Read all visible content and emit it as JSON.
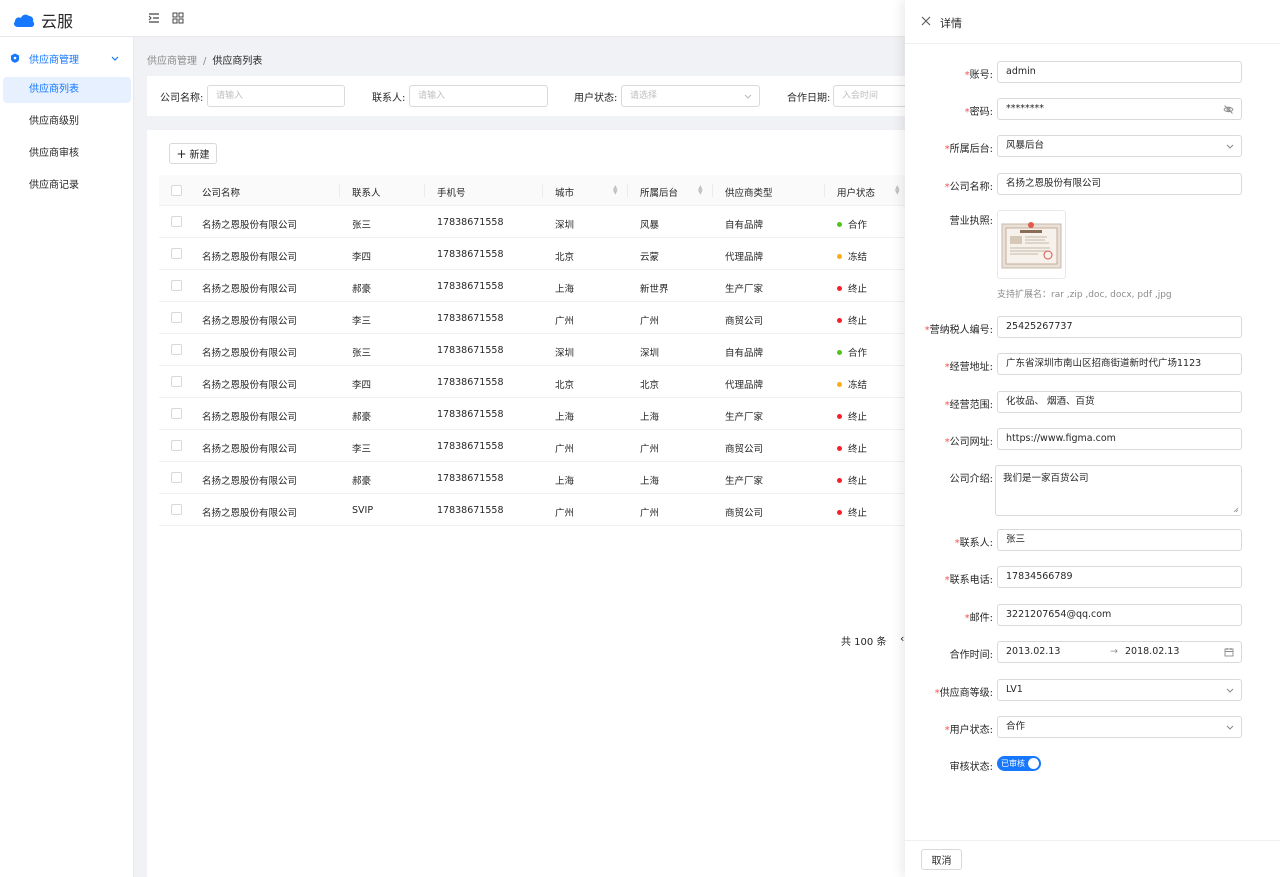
{
  "app": {
    "title": "云服"
  },
  "sidebar": {
    "group_label": "供应商管理",
    "items": [
      {
        "label": "供应商列表",
        "active": true
      },
      {
        "label": "供应商级别",
        "active": false
      },
      {
        "label": "供应商审核",
        "active": false
      },
      {
        "label": "供应商记录",
        "active": false
      }
    ]
  },
  "breadcrumb": {
    "parent": "供应商管理",
    "separator": "/",
    "current": "供应商列表"
  },
  "filters": {
    "company_label": "公司名称:",
    "company_placeholder": "请输入",
    "contact_label": "联系人:",
    "contact_placeholder": "请输入",
    "status_label": "用户状态:",
    "status_placeholder": "请选择",
    "date_label": "合作日期:",
    "date_placeholder": "入会时间"
  },
  "toolbar": {
    "new_label": "新建"
  },
  "table": {
    "columns": [
      "公司名称",
      "联系人",
      "手机号",
      "城市",
      "所属后台",
      "供应商类型",
      "用户状态"
    ],
    "rows": [
      {
        "company": "名扬之恩股份有限公司",
        "contact": "张三",
        "phone": "17838671558",
        "city": "深圳",
        "backend": "风暴",
        "type": "自有品牌",
        "status": "合作",
        "status_color": "#52c41a"
      },
      {
        "company": "名扬之恩股份有限公司",
        "contact": "李四",
        "phone": "17838671558",
        "city": "北京",
        "backend": "云蒙",
        "type": "代理品牌",
        "status": "冻结",
        "status_color": "#faad14"
      },
      {
        "company": "名扬之恩股份有限公司",
        "contact": "郝豪",
        "phone": "17838671558",
        "city": "上海",
        "backend": "新世界",
        "type": "生产厂家",
        "status": "终止",
        "status_color": "#f5222d"
      },
      {
        "company": "名扬之恩股份有限公司",
        "contact": "李三",
        "phone": "17838671558",
        "city": "广州",
        "backend": "广州",
        "type": "商贸公司",
        "status": "终止",
        "status_color": "#f5222d"
      },
      {
        "company": "名扬之恩股份有限公司",
        "contact": "张三",
        "phone": "17838671558",
        "city": "深圳",
        "backend": "深圳",
        "type": "自有品牌",
        "status": "合作",
        "status_color": "#52c41a"
      },
      {
        "company": "名扬之恩股份有限公司",
        "contact": "李四",
        "phone": "17838671558",
        "city": "北京",
        "backend": "北京",
        "type": "代理品牌",
        "status": "冻结",
        "status_color": "#faad14"
      },
      {
        "company": "名扬之恩股份有限公司",
        "contact": "郝豪",
        "phone": "17838671558",
        "city": "上海",
        "backend": "上海",
        "type": "生产厂家",
        "status": "终止",
        "status_color": "#f5222d"
      },
      {
        "company": "名扬之恩股份有限公司",
        "contact": "李三",
        "phone": "17838671558",
        "city": "广州",
        "backend": "广州",
        "type": "商贸公司",
        "status": "终止",
        "status_color": "#f5222d"
      },
      {
        "company": "名扬之恩股份有限公司",
        "contact": "郝豪",
        "phone": "17838671558",
        "city": "上海",
        "backend": "上海",
        "type": "生产厂家",
        "status": "终止",
        "status_color": "#f5222d"
      },
      {
        "company": "名扬之恩股份有限公司",
        "contact": "SVIP",
        "phone": "17838671558",
        "city": "广州",
        "backend": "广州",
        "type": "商贸公司",
        "status": "终止",
        "status_color": "#f5222d"
      }
    ]
  },
  "pagination": {
    "total_label": "共 100 条",
    "prev_glyph": "‹"
  },
  "drawer": {
    "title": "详情",
    "fields": {
      "account_label": "账号:",
      "account_value": "admin",
      "password_label": "密码:",
      "password_value": "********",
      "backend_label": "所属后台:",
      "backend_value": "风暴后台",
      "company_label": "公司名称:",
      "company_value": "名扬之恩股份有限公司",
      "license_label": "营业执照:",
      "license_hint": "支持扩展名：rar ,zip ,doc, docx, pdf ,jpg",
      "tax_label": "营纳税人编号:",
      "tax_value": "25425267737",
      "address_label": "经营地址:",
      "address_value": "广东省深圳市南山区招商街道新时代广场1123",
      "scope_label": "经营范围:",
      "scope_value": "化妆品、 烟酒、百货",
      "website_label": "公司网址:",
      "website_value": "https://www.figma.com",
      "intro_label": "公司介绍:",
      "intro_value": "我们是一家百货公司",
      "contact_label": "联系人:",
      "contact_value": "张三",
      "phone_label": "联系电话:",
      "phone_value": "17834566789",
      "email_label": "邮件:",
      "email_value": "3221207654@qq.com",
      "period_label": "合作时间:",
      "period_start": "2013.02.13",
      "period_arrow": "→",
      "period_end": "2018.02.13",
      "level_label": "供应商等级:",
      "level_value": "LV1",
      "status_label": "用户状态:",
      "status_value": "合作",
      "review_label": "审核状态:",
      "review_value": "已审核"
    },
    "cancel_label": "取消"
  },
  "colors": {
    "primary": "#1677ff",
    "required": "#ff4d4f"
  }
}
